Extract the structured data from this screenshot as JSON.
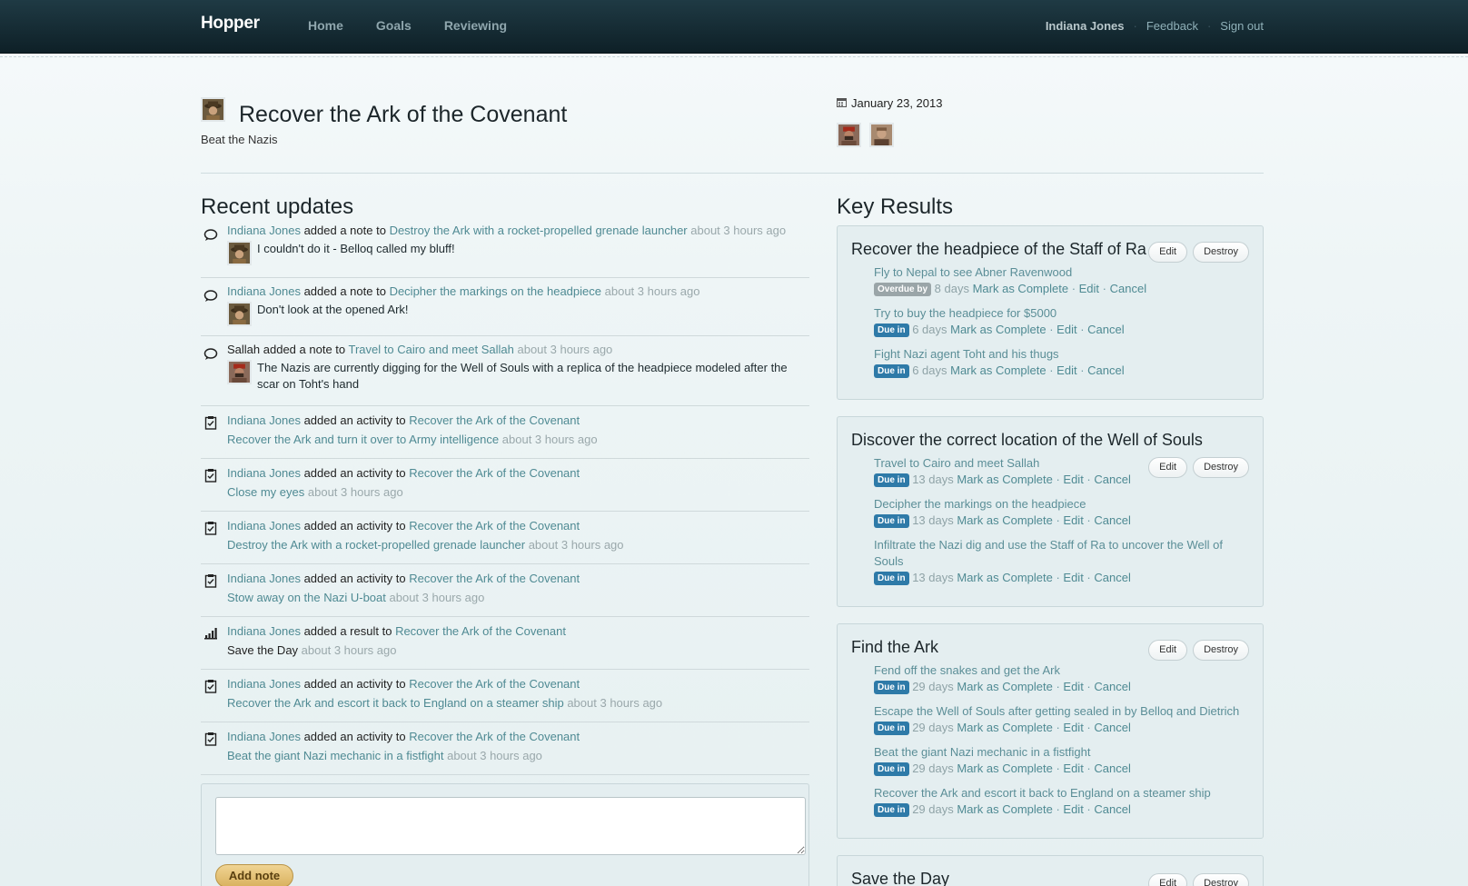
{
  "nav": {
    "brand": "Hopper",
    "links": [
      "Home",
      "Goals",
      "Reviewing"
    ],
    "user": "Indiana Jones",
    "feedback": "Feedback",
    "signout": "Sign out"
  },
  "goal": {
    "title": "Recover the Ark of the Covenant",
    "subtitle": "Beat the Nazis",
    "date": "January 23, 2013"
  },
  "updates": {
    "heading": "Recent updates",
    "items": [
      {
        "icon": "comment-icon",
        "actor": "Indiana Jones",
        "verb": "added a note to",
        "target": "Destroy the Ark with a rocket-propelled grenade launcher",
        "time": "about 3 hours ago",
        "note": "I couldn't do it - Belloq called my bluff!",
        "actor_linked": true
      },
      {
        "icon": "comment-icon",
        "actor": "Indiana Jones",
        "verb": "added a note to",
        "target": "Decipher the markings on the headpiece",
        "time": "about 3 hours ago",
        "note": "Don't look at the opened Ark!",
        "actor_linked": true
      },
      {
        "icon": "comment-icon",
        "actor": "Sallah",
        "verb": "added a note to",
        "target": "Travel to Cairo and meet Sallah",
        "time": "about 3 hours ago",
        "note": "The Nazis are currently digging for the Well of Souls with a replica of the headpiece modeled after the scar on Toht's hand",
        "actor_linked": false
      },
      {
        "icon": "clipboard-icon",
        "actor": "Indiana Jones",
        "verb": "added an activity to",
        "target": "Recover the Ark of the Covenant",
        "detail": "Recover the Ark and turn it over to Army intelligence",
        "time": "about 3 hours ago"
      },
      {
        "icon": "clipboard-icon",
        "actor": "Indiana Jones",
        "verb": "added an activity to",
        "target": "Recover the Ark of the Covenant",
        "detail": "Close my eyes",
        "time": "about 3 hours ago"
      },
      {
        "icon": "clipboard-icon",
        "actor": "Indiana Jones",
        "verb": "added an activity to",
        "target": "Recover the Ark of the Covenant",
        "detail": "Destroy the Ark with a rocket-propelled grenade launcher",
        "time": "about 3 hours ago"
      },
      {
        "icon": "clipboard-icon",
        "actor": "Indiana Jones",
        "verb": "added an activity to",
        "target": "Recover the Ark of the Covenant",
        "detail": "Stow away on the Nazi U-boat",
        "time": "about 3 hours ago"
      },
      {
        "icon": "bar-chart-icon",
        "actor": "Indiana Jones",
        "verb": "added a result to",
        "target": "Recover the Ark of the Covenant",
        "detail": "Save the Day",
        "time": "about 3 hours ago",
        "detail_plain": true
      },
      {
        "icon": "clipboard-icon",
        "actor": "Indiana Jones",
        "verb": "added an activity to",
        "target": "Recover the Ark of the Covenant",
        "detail": "Recover the Ark and escort it back to England on a steamer ship",
        "time": "about 3 hours ago"
      },
      {
        "icon": "clipboard-icon",
        "actor": "Indiana Jones",
        "verb": "added an activity to",
        "target": "Recover the Ark of the Covenant",
        "detail": "Beat the giant Nazi mechanic in a fistfight",
        "time": "about 3 hours ago"
      }
    ],
    "add_note_label": "Add note"
  },
  "key_results": {
    "heading": "Key Results",
    "edit_label": "Edit",
    "destroy_label": "Destroy",
    "mark_complete": "Mark as Complete",
    "edit_link": "Edit",
    "cancel_link": "Cancel",
    "items": [
      {
        "title": "Recover the headpiece of the Staff of Ra",
        "activities": [
          {
            "name": "Fly to Nepal to see Abner Ravenwood",
            "badge": "Overdue by",
            "badge_type": "over",
            "days": "8 days"
          },
          {
            "name": "Try to buy the headpiece for $5000",
            "badge": "Due in",
            "badge_type": "due",
            "days": "6 days"
          },
          {
            "name": "Fight Nazi agent Toht and his thugs",
            "badge": "Due in",
            "badge_type": "due",
            "days": "6 days"
          }
        ]
      },
      {
        "title": "Discover the correct location of the Well of Souls",
        "activities": [
          {
            "name": "Travel to Cairo and meet Sallah",
            "badge": "Due in",
            "badge_type": "due",
            "days": "13 days"
          },
          {
            "name": "Decipher the markings on the headpiece",
            "badge": "Due in",
            "badge_type": "due",
            "days": "13 days"
          },
          {
            "name": "Infiltrate the Nazi dig and use the Staff of Ra to uncover the Well of Souls",
            "badge": "Due in",
            "badge_type": "due",
            "days": "13 days"
          }
        ]
      },
      {
        "title": "Find the Ark",
        "activities": [
          {
            "name": "Fend off the snakes and get the Ark",
            "badge": "Due in",
            "badge_type": "due",
            "days": "29 days"
          },
          {
            "name": "Escape the Well of Souls after getting sealed in by Belloq and Dietrich",
            "badge": "Due in",
            "badge_type": "due",
            "days": "29 days"
          },
          {
            "name": "Beat the giant Nazi mechanic in a fistfight",
            "badge": "Due in",
            "badge_type": "due",
            "days": "29 days"
          },
          {
            "name": "Recover the Ark and escort it back to England on a steamer ship",
            "badge": "Due in",
            "badge_type": "due",
            "days": "29 days"
          }
        ]
      },
      {
        "title": "Save the Day",
        "activities": []
      }
    ]
  }
}
